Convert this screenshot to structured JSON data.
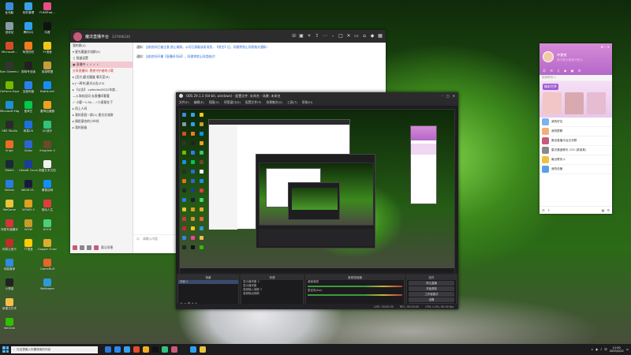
{
  "desktop_icons": [
    {
      "label": "此电脑",
      "color": "#3b8be0"
    },
    {
      "label": "回收站",
      "color": "#8a9aa8"
    },
    {
      "label": "Microsoft...",
      "color": "#d84a2c"
    },
    {
      "label": "Epic Games Launcher",
      "color": "#333333"
    },
    {
      "label": "GeForce Experience",
      "color": "#76b900"
    },
    {
      "label": "Microsoft Edge",
      "color": "#1f8fd9"
    },
    {
      "label": "OBS Studio",
      "color": "#2b2b2b"
    },
    {
      "label": "Origin",
      "color": "#f06a27"
    },
    {
      "label": "Steam",
      "color": "#1b2838"
    },
    {
      "label": "ToDesk",
      "color": "#2a7be4"
    },
    {
      "label": "WeGame",
      "color": "#e9c23e"
    },
    {
      "label": "网易有道翻译",
      "color": "#d8333a"
    },
    {
      "label": "网易云音乐",
      "color": "#c8292b"
    },
    {
      "label": "电脑管家",
      "color": "#2f8ae0"
    },
    {
      "label": "小黑盒",
      "color": "#222222"
    },
    {
      "label": "软件管理",
      "color": "#3aa1e8"
    },
    {
      "label": "腾讯QQ",
      "color": "#2ea0f0"
    },
    {
      "label": "阿里旺旺",
      "color": "#f47b20"
    },
    {
      "label": "剪映专业版",
      "color": "#222222"
    },
    {
      "label": "百度网盘",
      "color": "#2c7ef0"
    },
    {
      "label": "爱奇艺",
      "color": "#00c94d"
    },
    {
      "label": "网易UU",
      "color": "#1f6fe0"
    },
    {
      "label": "Uplay",
      "color": "#2b66d4"
    },
    {
      "label": "Ubisoft Connect",
      "color": "#1e3c9c"
    },
    {
      "label": "World of...",
      "color": "#1a1a40"
    },
    {
      "label": "WOW5.0",
      "color": "#e0a020"
    },
    {
      "label": "WOW",
      "color": "#c89a2a"
    },
    {
      "label": "TT语音",
      "color": "#ffcc00"
    },
    {
      "label": "FUNITrad...",
      "color": "#e94c8a"
    },
    {
      "label": "抖音",
      "color": "#111111"
    },
    {
      "label": "YY语音",
      "color": "#f5c518"
    },
    {
      "label": "英雄联盟",
      "color": "#c89b3c"
    },
    {
      "label": "Battle.net",
      "color": "#148eff"
    },
    {
      "label": "雷神加速器",
      "color": "#f0a020"
    },
    {
      "label": "QQ音乐",
      "color": "#31c27c"
    },
    {
      "label": "Kingdom II",
      "color": "#6a4a2a"
    },
    {
      "label": "新建文本文档",
      "color": "#f2f2f2"
    },
    {
      "label": "暴雪战网",
      "color": "#148eff"
    },
    {
      "label": "驱动人生",
      "color": "#e03c3c"
    },
    {
      "label": "KOOK",
      "color": "#4ad07a"
    },
    {
      "label": "Google Chrome",
      "color": "#e0ac2c"
    },
    {
      "label": "GameBuff",
      "color": "#e8652a"
    },
    {
      "label": "Wallpaper",
      "color": "#2c9ad8"
    },
    {
      "label": "新建文件夹",
      "color": "#f0c04a"
    },
    {
      "label": "WeChat",
      "color": "#2dc100"
    },
    {
      "label": "迅雷",
      "color": "#2a7ae4"
    },
    {
      "label": "PotPlayer",
      "color": "#f0b020"
    },
    {
      "label": "Dota 2",
      "color": "#b32a1a"
    },
    {
      "label": "GameBuff",
      "color": "#f07030"
    },
    {
      "label": "钉钉",
      "color": "#2a8af0"
    },
    {
      "label": "新建文本文档",
      "color": "#ffffff"
    }
  ],
  "chat": {
    "title": "魔法直播平台",
    "subtitle": "237096330",
    "notices": [
      {
        "label": "通知：",
        "text": "当前房间已被注意,禁止刷屏。公司已屏蔽该条消息，【禁言】后，同理将禁止同类格式通知!"
      },
      {
        "label": "通知：",
        "text": "当前房间开播【直播间号码】，同理将禁止同类格式！"
      }
    ],
    "tree": [
      {
        "text": "我的群(2)",
        "cls": ""
      },
      {
        "text": "▾ 星光魔盒交流群(5)",
        "cls": ""
      },
      {
        "text": "  ♫ 频道设置",
        "cls": ""
      },
      {
        "text": "  ▣ 直播中 ✓ ✓ ✓ ✓",
        "cls": "sel"
      },
      {
        "text": "分享直播间: 黑夜守护者的小窝",
        "cls": "red"
      },
      {
        "text": "▸ [官方]星光魔盒 聊天室(9)",
        "cls": ""
      },
      {
        "text": "▸ [一周年]星光公告(23)",
        "cls": ""
      },
      {
        "text": "  ▸ 【公告】 collected2022年度...",
        "cls": ""
      },
      {
        "text": "  —入场欢迎词 去直播间看看",
        "cls": ""
      },
      {
        "text": "  ✓ 小鹿一1.5k...  ✓小星星在下",
        "cls": ""
      },
      {
        "text": "▸ 同上人间",
        "cls": ""
      },
      {
        "text": "▸ 我的家庭一群(1) 星光交流群",
        "cls": ""
      },
      {
        "text": "▸ 情投意合的小伙伴",
        "cls": ""
      },
      {
        "text": "▸ 我的班级",
        "cls": ""
      }
    ],
    "input_placeholder": "请输入内容",
    "bottom_labels": [
      "魔法直播",
      "发送"
    ]
  },
  "obs": {
    "title": "OBS 29.1.3 (64-bit, windows) - 配置文件: 未命名 - 场景: 未命名",
    "menu": [
      "文件(F)",
      "编辑(E)",
      "视图(V)",
      "停靠窗口(D)",
      "配置文件(P)",
      "场景集合(S)",
      "工具(T)",
      "帮助(H)"
    ],
    "docks": {
      "scenes": {
        "header": "场景",
        "items": [
          "场景 2"
        ]
      },
      "sources": {
        "header": "来源",
        "items": [
          "显示器采集 2",
          "显示器采集",
          "音频输入捕获 2",
          "音频输出捕获"
        ]
      },
      "mixer": {
        "header": "音频混音器",
        "items": [
          "桌面音频",
          "麦克风/Aux"
        ]
      },
      "controls": {
        "header": "控件",
        "buttons": [
          "停止直播",
          "开始录制",
          "工作室模式",
          "设置",
          "退出"
        ]
      }
    },
    "status": [
      "LIVE: 00:00:00",
      "REC: 00:00:00",
      "CPU: 0.4%, 60.00 fps"
    ]
  },
  "qq": {
    "name": "仲夏夜",
    "signature": "我不是大神我只是大...",
    "banner": "精彩世界",
    "rows": [
      {
        "text": "我的好友",
        "color": "#7bb3f0"
      },
      {
        "text": "我的群聊",
        "color": "#f0b07b"
      },
      {
        "text": "魔法直播平台交流群",
        "color": "#c85a7a"
      },
      {
        "text": "星光魔盒聊天 123 (某某某)",
        "color": "#8a8a8a"
      },
      {
        "text": "最近联系人",
        "color": "#f0c040"
      },
      {
        "text": "我的设备",
        "color": "#5aa0e8"
      }
    ],
    "search_placeholder": "搜索联系人"
  },
  "taskbar": {
    "search_placeholder": "在这里输入你要搜索的内容",
    "time": "11:50",
    "date": "2023/2/22",
    "apps": [
      "#2a7ad8",
      "#2a8af0",
      "#3aa0f0",
      "#e84a2c",
      "#f0b020",
      "#111111",
      "#31c27c",
      "#c85a7a",
      "#1d1d1d",
      "#2ea0f0",
      "#e9c23e"
    ]
  }
}
